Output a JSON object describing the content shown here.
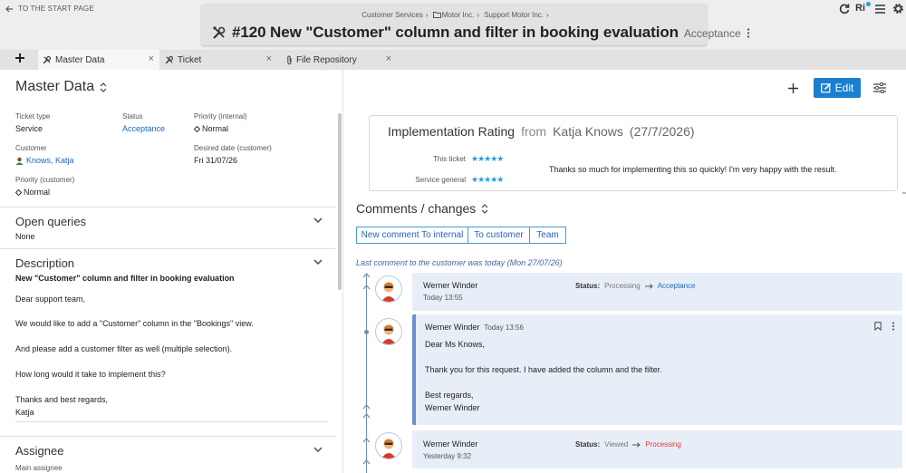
{
  "topbar": {
    "back_label": "TO THE START PAGE",
    "breadcrumb": [
      "Customer Services",
      "Motor Inc.",
      "Support Motor Inc."
    ],
    "ticket_title": "#120 New \"Customer\" column and filter in booking evaluation",
    "ticket_status": "Acceptance",
    "user_initials": "Ri"
  },
  "tabs": [
    {
      "label": "Master Data"
    },
    {
      "label": "Ticket"
    },
    {
      "label": "File Repository"
    }
  ],
  "master": {
    "heading": "Master Data",
    "fields": {
      "ticket_type_label": "Ticket type",
      "ticket_type": "Service",
      "status_label": "Status",
      "status": "Acceptance",
      "priority_internal_label": "Priority (internal)",
      "priority_internal": "Normal",
      "customer_label": "Customer",
      "customer": "Knows, Katja",
      "desired_label": "Desired date (customer)",
      "desired": "Fri 31/07/26",
      "priority_customer_label": "Priority (customer)",
      "priority_customer": "Normal"
    },
    "open_queries": {
      "title": "Open queries",
      "value": "None"
    },
    "description": {
      "title": "Description",
      "subject": "New \"Customer\" column and filter in booking evaluation",
      "lines": [
        "Dear support team,",
        "We would like to add a \"Customer\" column in the \"Bookings\" view.",
        "And please add a customer filter as well (multiple selection).",
        "How long would it take to implement this?",
        "Thanks and best regards,",
        "Katja"
      ]
    },
    "assignee": {
      "title": "Assignee",
      "sub": "Main assignee"
    }
  },
  "toolbar": {
    "edit_label": "Edit"
  },
  "rating": {
    "title": "Implementation Rating",
    "from": "from",
    "person": "Katja Knows",
    "date": "(27/7/2026)",
    "this_ticket_label": "This ticket",
    "service_label": "Service general",
    "stars": "★★★★★",
    "comment": "Thanks so much for implementing this so quickly! I'm very happy with the result."
  },
  "comments": {
    "heading": "Comments / changes",
    "buttons": [
      "New comment To internal",
      "To customer",
      "Team"
    ],
    "last_note": "Last comment to the customer was today (Mon 27/07/26)",
    "entries": [
      {
        "author": "Werner Winder",
        "time": "Today 13:55",
        "status_label": "Status:",
        "from": "Processing",
        "to": "Acceptance"
      },
      {
        "author": "Werner Winder",
        "time": "Today 13:56",
        "lines": [
          "Dear Ms Knows,",
          "Thank you for this request. I have added the column and the filter.",
          "Best regards,",
          "Werner Winder"
        ]
      },
      {
        "author": "Werner Winder",
        "time": "Yesterday 9:32",
        "status_label": "Status:",
        "from": "Viewed",
        "to": "Processing"
      }
    ]
  },
  "colors": {
    "accent": "#2065c6",
    "edit_bg": "#1a7fd0",
    "processing_red": "#e53935",
    "entry_bg": "#e8eef7"
  }
}
